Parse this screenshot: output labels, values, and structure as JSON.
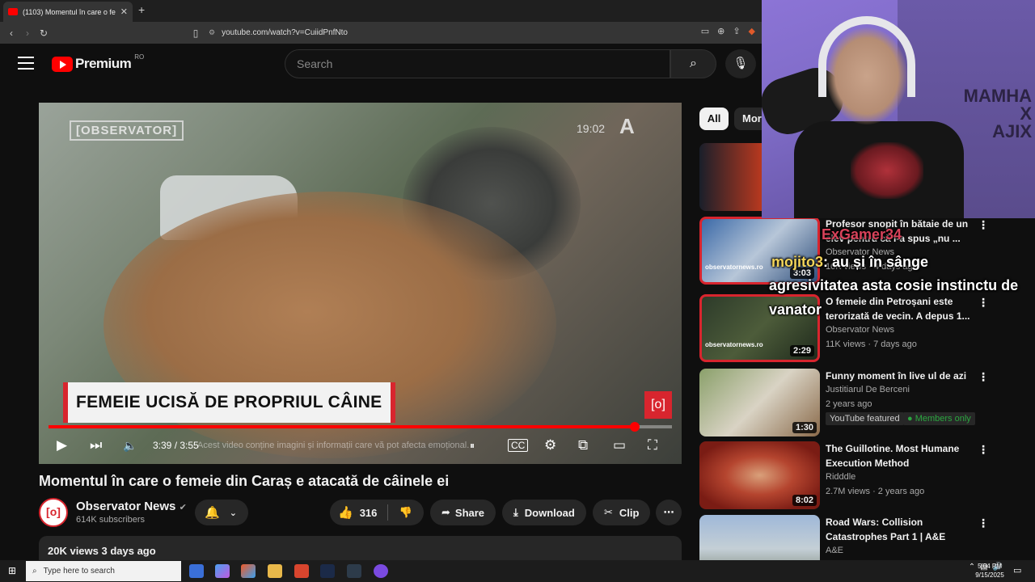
{
  "browser": {
    "tab_title": "(1103) Momentul în care o feme",
    "tab_close": "✕",
    "new_tab": "+",
    "url": "youtube.com/watch?v=CuiidPnfNto"
  },
  "header": {
    "logo_text": "Premium",
    "country": "RO",
    "search_placeholder": "Search"
  },
  "video": {
    "watermark": "[OBSERVATOR]",
    "clock": "19:02",
    "channel_logo": "A",
    "lower_third": "FEMEIE UCISĂ DE PROPRIUL CÂINE",
    "badge": "[o]",
    "time": "3:39 / 3:55",
    "warning": "Acest video conține imagini și informații care vă pot afecta emoțional.",
    "progress": 0.94
  },
  "title": "Momentul în care o femeie din Caraș e atacată de câinele ei",
  "channel": {
    "avatar": "[o]",
    "name": "Observator News",
    "subscribers": "614K subscribers"
  },
  "actions": {
    "likes": "316",
    "share": "Share",
    "download": "Download",
    "clip": "Clip",
    "more": "⋯"
  },
  "description": {
    "stats": "20K views  3 days ago"
  },
  "sidebar": {
    "chips": [
      "All",
      "More"
    ],
    "recommendations": [
      {
        "title": "Profesor snopit în bătaie de un elev pentru că i-a spus „nu ...",
        "channel": "Observator News",
        "meta": "10K views · 4 days ago",
        "duration": "3:03",
        "thumb_note": "observatornews.ro"
      },
      {
        "title": "O femeie din Petroșani este terorizată de vecin. A depus 1...",
        "channel": "Observator News",
        "meta": "11K views · 7 days ago",
        "duration": "2:29",
        "thumb_note": "observatornews.ro"
      },
      {
        "title": "Funny moment în live ul de azi",
        "channel": "Justitiarul De Berceni",
        "meta": "2 years ago",
        "duration": "1:30",
        "tag1": "YouTube featured",
        "tag2": "Members only"
      },
      {
        "title": "The Guillotine. Most Humane Execution Method",
        "channel": "Ridddle",
        "meta": "2.7M views · 2 years ago",
        "duration": "8:02"
      },
      {
        "title": "Road Wars: Collision Catastrophes Part 1 | A&E",
        "channel": "A&E",
        "meta": "",
        "duration": ""
      }
    ]
  },
  "stream_overlay": {
    "poster_text": "MAMHA\nX\nAJIX",
    "chat_user1": "ExGamer34",
    "chat_user2": "mojito3",
    "chat_msg2": ": au și în sânge",
    "chat_msg2b": "agresivitatea asta cosie instinctu de",
    "chat_msg2c": "vanator"
  },
  "taskbar": {
    "search_placeholder": "Type here to search",
    "time": "5:04 PM",
    "date": "9/15/2025"
  },
  "colors": {
    "accent": "#ff0000",
    "bg": "#0f0f0f",
    "pill": "#272727",
    "members": "#2ba640"
  }
}
